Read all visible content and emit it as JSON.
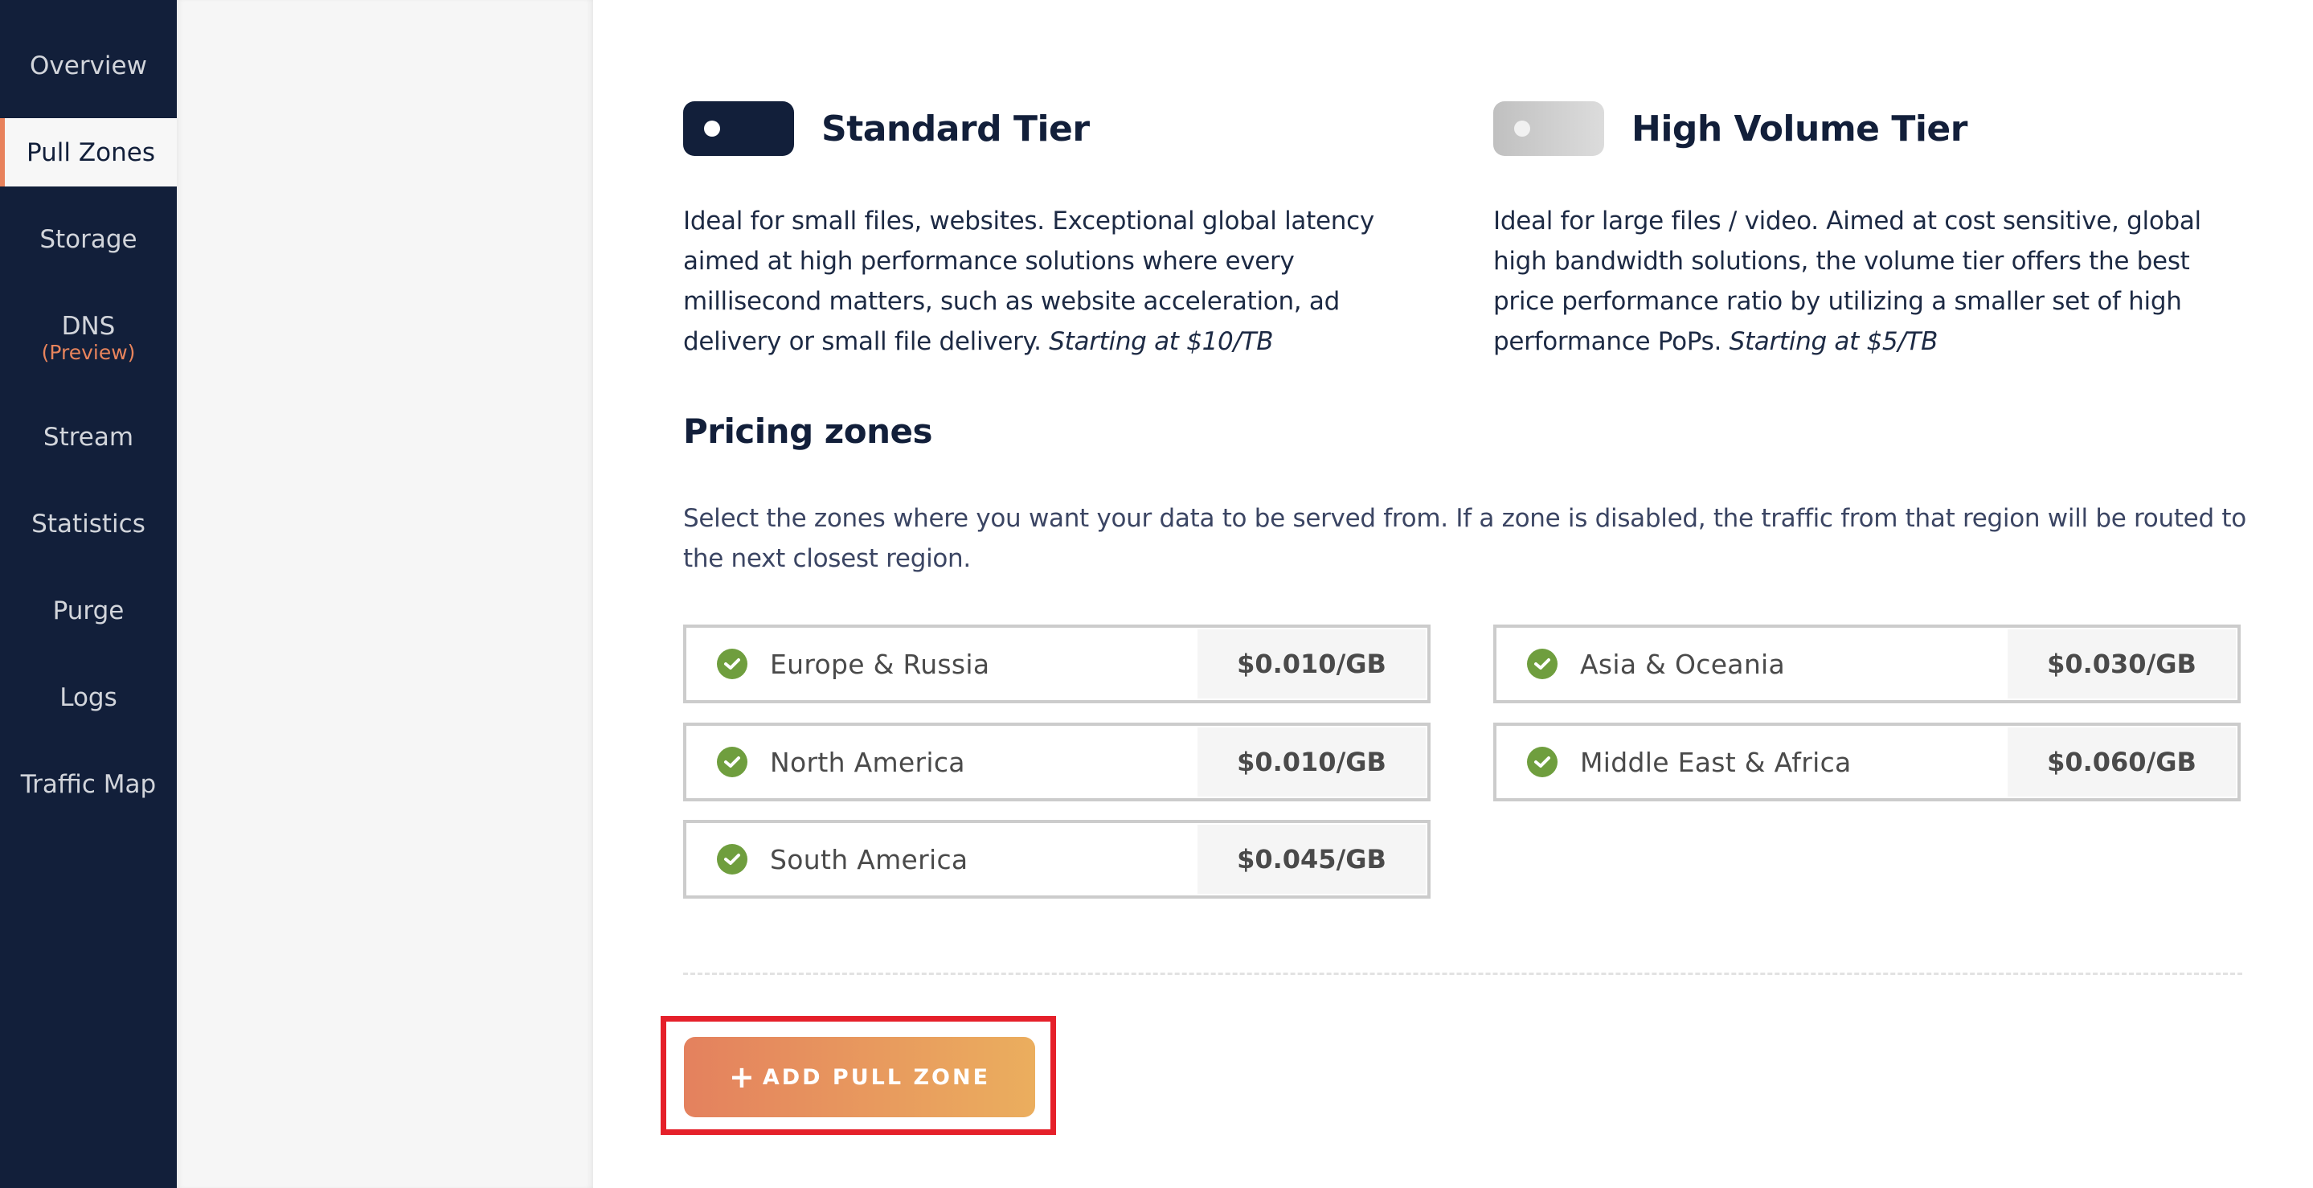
{
  "sidebar": {
    "items": [
      {
        "label": "Overview",
        "active": false
      },
      {
        "label": "Pull Zones",
        "active": true
      },
      {
        "label": "Storage",
        "active": false
      },
      {
        "label": "DNS",
        "sub": "(Preview)",
        "active": false
      },
      {
        "label": "Stream",
        "active": false
      },
      {
        "label": "Statistics",
        "active": false
      },
      {
        "label": "Purge",
        "active": false
      },
      {
        "label": "Logs",
        "active": false
      },
      {
        "label": "Traffic Map",
        "active": false
      }
    ]
  },
  "tiers": [
    {
      "title": "Standard Tier",
      "enabled": true,
      "description": "Ideal for small files, websites. Exceptional global latency aimed at high performance solutions where every millisecond matters, such as website acceleration, ad delivery or small file delivery. ",
      "starting_price": "Starting at $10/TB"
    },
    {
      "title": "High Volume Tier",
      "enabled": false,
      "description": "Ideal for large files / video. Aimed at cost sensitive, global high bandwidth solutions, the volume tier offers the best price performance ratio by utilizing a smaller set of high performance PoPs. ",
      "starting_price": "Starting at $5/TB"
    }
  ],
  "pricing": {
    "title": "Pricing zones",
    "description": "Select the zones where you want your data to be served from. If a zone is disabled, the traffic from that region will be routed to the next closest region.",
    "zones": [
      {
        "name": "Europe & Russia",
        "price": "$0.010/GB",
        "enabled": true
      },
      {
        "name": "Asia & Oceania",
        "price": "$0.030/GB",
        "enabled": true
      },
      {
        "name": "North America",
        "price": "$0.010/GB",
        "enabled": true
      },
      {
        "name": "Middle East & Africa",
        "price": "$0.060/GB",
        "enabled": true
      },
      {
        "name": "South America",
        "price": "$0.045/GB",
        "enabled": true
      }
    ]
  },
  "actions": {
    "add_pull_zone": "ADD PULL ZONE",
    "add_icon": "+"
  },
  "colors": {
    "sidebar_bg": "#121f3a",
    "accent_orange": "#e8825c",
    "check_green": "#6f9e3e",
    "highlight_red": "#e5202a"
  }
}
